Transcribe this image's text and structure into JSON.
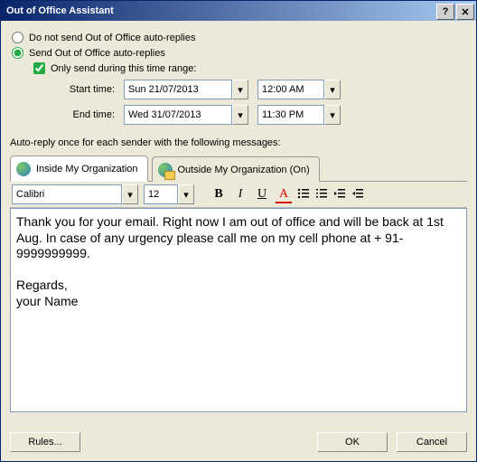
{
  "window": {
    "title": "Out of Office Assistant"
  },
  "options": {
    "radio_noautoreply": "Do not send Out of Office auto-replies",
    "radio_sendautoreply": "Send Out of Office auto-replies",
    "chk_timerange": "Only send during this time range:"
  },
  "time": {
    "start_label": "Start time:",
    "start_date": "Sun 21/07/2013",
    "start_time": "12:00 AM",
    "end_label": "End time:",
    "end_date": "Wed 31/07/2013",
    "end_time": "11:30 PM"
  },
  "prompt": "Auto-reply once for each sender with the following messages:",
  "tabs": {
    "inside": "Inside My Organization",
    "outside": "Outside My Organization (On)"
  },
  "format": {
    "font": "Calibri",
    "size": "12",
    "bold": "B",
    "italic": "I",
    "underline": "U",
    "color": "A"
  },
  "message": "Thank you for your email. Right now I am out of office and will be back at 1st Aug. In case of any urgency please call me on my cell phone at + 91-9999999999.\n\nRegards,\nyour Name",
  "buttons": {
    "rules": "Rules...",
    "ok": "OK",
    "cancel": "Cancel"
  }
}
